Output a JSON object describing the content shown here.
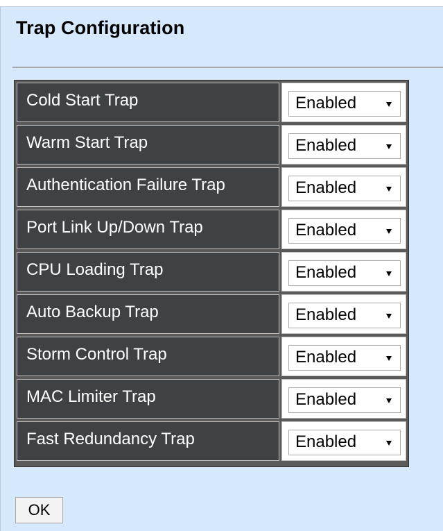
{
  "page": {
    "title": "Trap Configuration"
  },
  "traps": [
    {
      "label": "Cold Start Trap",
      "value": "Enabled"
    },
    {
      "label": "Warm Start Trap",
      "value": "Enabled"
    },
    {
      "label": "Authentication Failure Trap",
      "value": "Enabled"
    },
    {
      "label": "Port Link Up/Down Trap",
      "value": "Enabled"
    },
    {
      "label": "CPU Loading Trap",
      "value": "Enabled"
    },
    {
      "label": "Auto Backup Trap",
      "value": "Enabled"
    },
    {
      "label": "Storm Control Trap",
      "value": "Enabled"
    },
    {
      "label": "MAC Limiter Trap",
      "value": "Enabled"
    },
    {
      "label": "Fast Redundancy Trap",
      "value": "Enabled"
    }
  ],
  "actions": {
    "ok_label": "OK"
  },
  "colors": {
    "panel_background": "#d6e8fb",
    "label_cell_background": "#3f4244",
    "table_frame": "#5a5a5a"
  },
  "icons": {
    "dropdown": "triangle-down-icon"
  }
}
